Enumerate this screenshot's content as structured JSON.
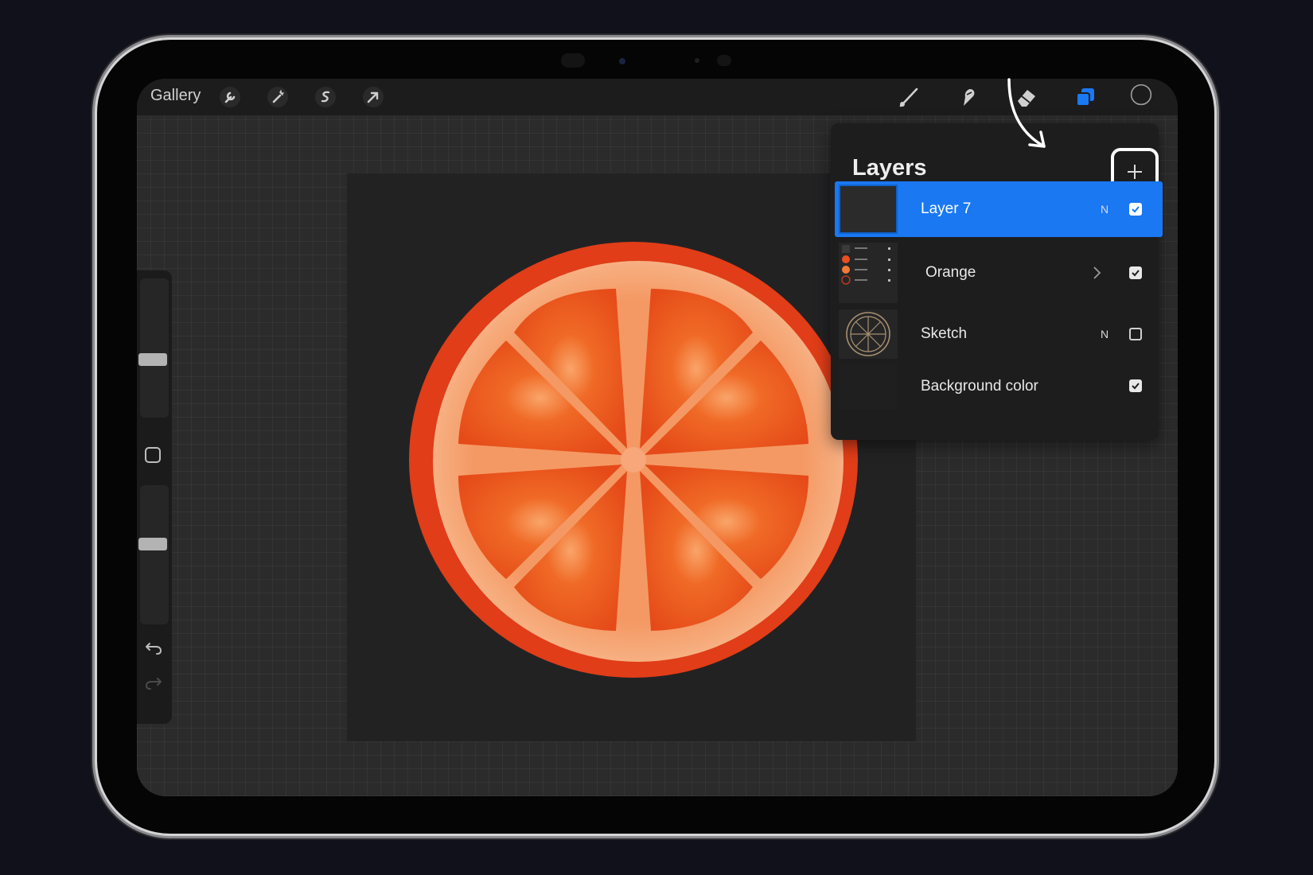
{
  "toolbar": {
    "gallery_label": "Gallery",
    "left_tools": [
      "wrench-icon",
      "magic-wand-icon",
      "selection-icon",
      "transform-arrow-icon"
    ],
    "right_tools": [
      "brush-icon",
      "smudge-icon",
      "eraser-icon",
      "layers-icon",
      "color-swatch"
    ],
    "active_color": "#1a78f2"
  },
  "layers": {
    "title": "Layers",
    "items": [
      {
        "name": "Layer 7",
        "blend": "N",
        "visible": true,
        "active": true
      },
      {
        "name": "Orange",
        "blend": "",
        "visible": true,
        "active": false,
        "group": true
      },
      {
        "name": "Sketch",
        "blend": "N",
        "visible": false,
        "active": false
      },
      {
        "name": "Background color",
        "blend": "",
        "visible": true,
        "active": false
      }
    ]
  },
  "colors": {
    "accent": "#1a78f2",
    "orange_peel": "#e2451d",
    "orange_pith": "#f6a473",
    "orange_flesh": "#f06a26"
  }
}
